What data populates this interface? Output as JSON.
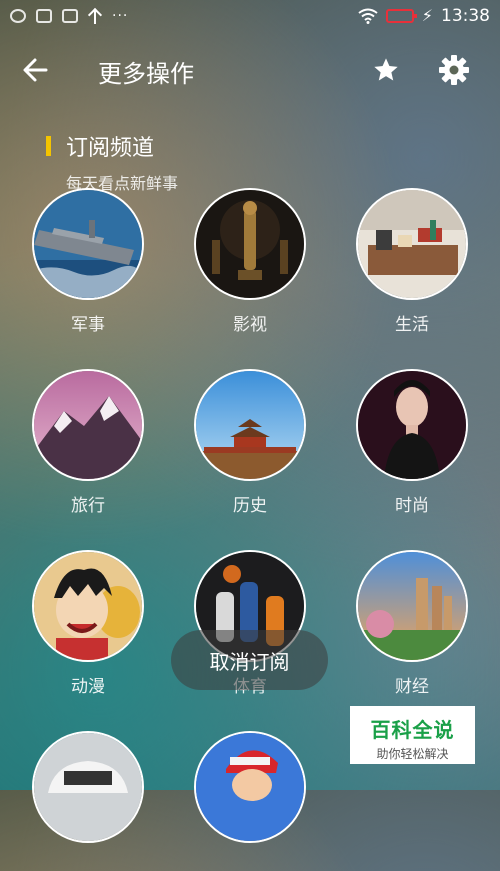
{
  "status_bar": {
    "time": "13:38",
    "left_icons": [
      "butterfly-icon",
      "message-icon",
      "image-icon",
      "upload-arrow-icon"
    ],
    "more": "···",
    "right_icons": [
      "wifi-icon",
      "battery-icon",
      "charging-icon"
    ],
    "battery_color": "#e8303a"
  },
  "header": {
    "title": "更多操作",
    "back_icon": "arrow-left-icon",
    "favorite_icon": "star-icon",
    "settings_icon": "gear-icon"
  },
  "section": {
    "title": "订阅频道",
    "subtitle": "每天看点新鲜事",
    "accent_color": "#f4c400"
  },
  "channels": [
    {
      "label": "军事"
    },
    {
      "label": "影视"
    },
    {
      "label": "生活"
    },
    {
      "label": "旅行"
    },
    {
      "label": "历史"
    },
    {
      "label": "时尚"
    },
    {
      "label": "动漫"
    },
    {
      "label": "体育"
    },
    {
      "label": "财经"
    },
    {
      "label": ""
    },
    {
      "label": ""
    }
  ],
  "toast": {
    "text": "取消订阅"
  },
  "watermark": {
    "title": "百科全说",
    "subtitle": "助你轻松解决",
    "color": "#1aa048"
  }
}
